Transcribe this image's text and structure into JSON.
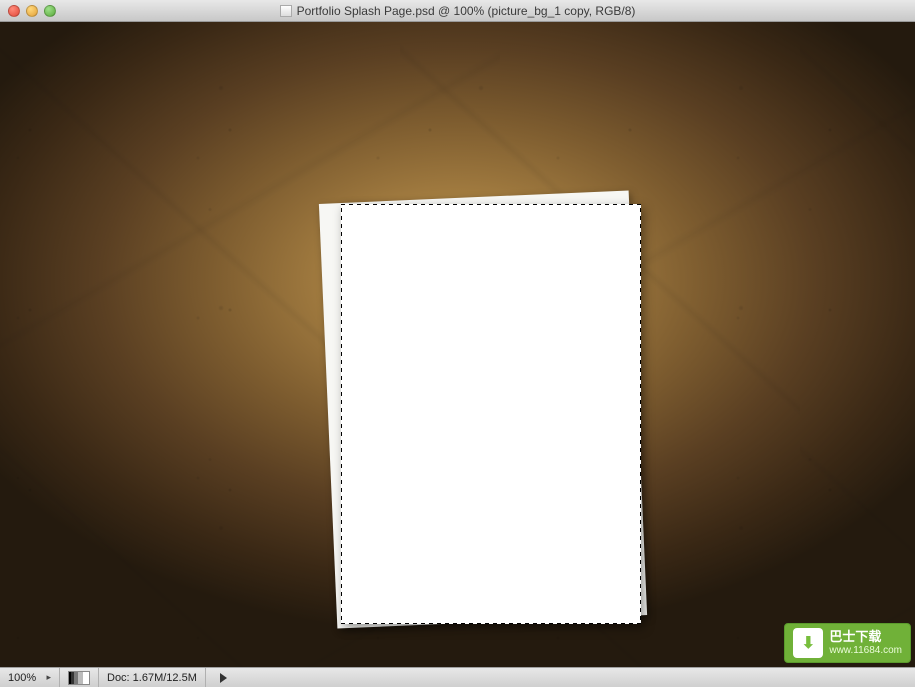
{
  "window": {
    "title": "Portfolio Splash Page.psd @ 100% (picture_bg_1 copy, RGB/8)"
  },
  "statusbar": {
    "zoom": "100%",
    "doc_size": "Doc: 1.67M/12.5M"
  },
  "watermark": {
    "brand": "巴士下载",
    "url": "www.11684.com"
  }
}
